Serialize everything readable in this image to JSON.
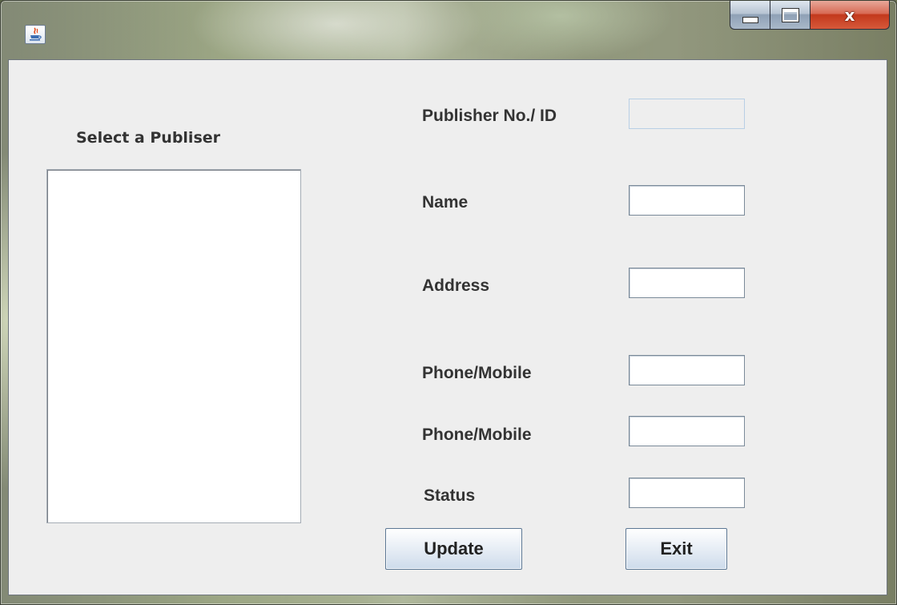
{
  "window": {
    "title": "",
    "app_icon": "java-cup-icon",
    "controls": {
      "minimize": "minimize-icon",
      "maximize": "maximize-icon",
      "close": "x"
    }
  },
  "list": {
    "title": "Select a Publiser",
    "items": []
  },
  "form": {
    "fields": [
      {
        "label": "Publisher No./ ID",
        "value": "",
        "enabled": false
      },
      {
        "label": "Name",
        "value": "",
        "enabled": true
      },
      {
        "label": "Address",
        "value": "",
        "enabled": true
      },
      {
        "label": "Phone/Mobile",
        "value": "",
        "enabled": true
      },
      {
        "label": "Phone/Mobile",
        "value": "",
        "enabled": true
      },
      {
        "label": "Status",
        "value": "",
        "enabled": true
      }
    ]
  },
  "buttons": {
    "update": "Update",
    "exit": "Exit"
  },
  "colors": {
    "client_bg": "#eeeeee",
    "close_button": "#c3381c",
    "label_text": "#333333"
  }
}
